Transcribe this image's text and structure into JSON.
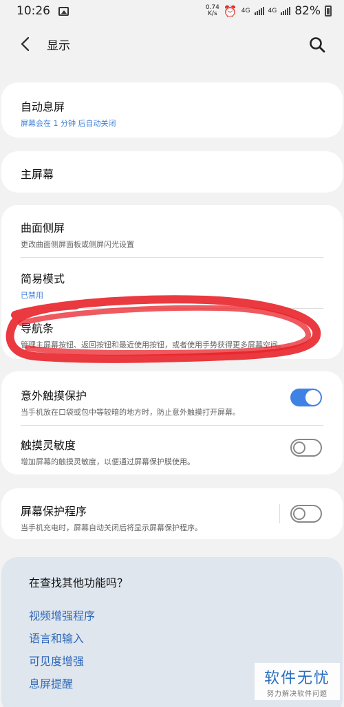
{
  "status_bar": {
    "time": "10:26",
    "speed_value": "0.74",
    "speed_unit": "K/s",
    "network_1": "4G",
    "network_2": "4G",
    "battery": "82%"
  },
  "header": {
    "title": "显示"
  },
  "items": {
    "auto_screen_off": {
      "title": "自动息屏",
      "subtitle": "屏幕会在 1 分钟 后自动关闭"
    },
    "home_screen": {
      "title": "主屏幕"
    },
    "edge_screen": {
      "title": "曲面侧屏",
      "subtitle": "更改曲面侧屏面板或侧屏闪光设置"
    },
    "easy_mode": {
      "title": "简易模式",
      "subtitle": "已禁用"
    },
    "navigation_bar": {
      "title": "导航条",
      "subtitle": "管理主屏幕按钮、返回按钮和最近使用按钮，或者使用手势获得更多屏幕空间。"
    },
    "accidental_touch": {
      "title": "意外触摸保护",
      "subtitle": "当手机放在口袋或包中等较暗的地方时，防止意外触摸打开屏幕。",
      "enabled": true
    },
    "touch_sensitivity": {
      "title": "触摸灵敏度",
      "subtitle": "增加屏幕的触摸灵敏度，以便通过屏幕保护膜使用。",
      "enabled": false
    },
    "screen_saver": {
      "title": "屏幕保护程序",
      "subtitle": "当手机充电时，屏幕自动关闭后将显示屏幕保护程序。",
      "enabled": false
    }
  },
  "suggestions": {
    "title": "在查找其他功能吗？",
    "links": [
      "视频增强程序",
      "语言和输入",
      "可见度增强",
      "息屏提醒"
    ]
  },
  "watermark": {
    "main": "软件无忧",
    "sub": "努力解决软件问题"
  },
  "colors": {
    "accent": "#3f82e6",
    "annotation": "#e8232a",
    "link": "#2f68b8"
  }
}
